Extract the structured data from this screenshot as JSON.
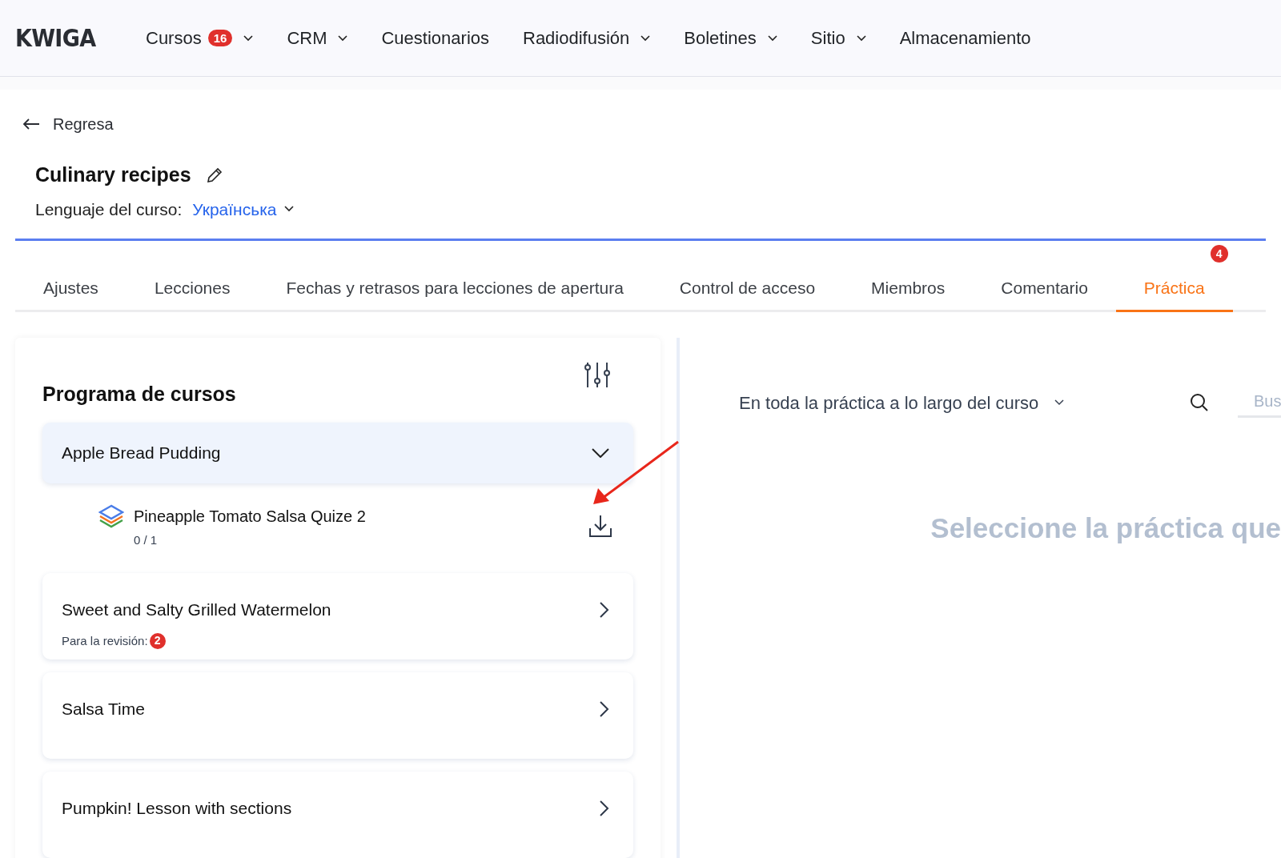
{
  "header": {
    "logo": "KWIGA",
    "nav": [
      {
        "label": "Cursos",
        "badge": "16",
        "has_menu": true
      },
      {
        "label": "CRM",
        "has_menu": true
      },
      {
        "label": "Cuestionarios",
        "has_menu": false
      },
      {
        "label": "Radiodifusión",
        "has_menu": true
      },
      {
        "label": "Boletines",
        "has_menu": true
      },
      {
        "label": "Sitio",
        "has_menu": true
      },
      {
        "label": "Almacenamiento",
        "has_menu": false
      }
    ]
  },
  "back_link": "Regresa",
  "course": {
    "title": "Culinary recipes",
    "language_label": "Lenguaje del curso:",
    "language": "Українська"
  },
  "tabs": [
    {
      "label": "Ajustes",
      "selected": false
    },
    {
      "label": "Lecciones",
      "selected": false
    },
    {
      "label": "Fechas y retrasos para lecciones de apertura",
      "selected": false
    },
    {
      "label": "Control de acceso",
      "selected": false
    },
    {
      "label": "Miembros",
      "selected": false
    },
    {
      "label": "Comentario",
      "selected": false
    },
    {
      "label": "Práctica",
      "selected": true,
      "badge": "4"
    }
  ],
  "program": {
    "title": "Programa de cursos",
    "lessons": [
      {
        "title": "Apple Bread Pudding",
        "expanded": true,
        "children": [
          {
            "title": "Pineapple Tomato Salsa Quize 2",
            "progress": "0 / 1"
          }
        ]
      },
      {
        "title": "Sweet and Salty Grilled Watermelon",
        "expanded": false,
        "review_label": "Para la revisión:",
        "review_count": "2"
      },
      {
        "title": "Salsa Time",
        "expanded": false
      },
      {
        "title": "Pumpkin! Lesson with sections",
        "expanded": false
      }
    ]
  },
  "practice": {
    "filter": "En toda la práctica a lo largo del curso",
    "search": {
      "placeholder": "Bus"
    },
    "empty_message": "Seleccione la práctica que"
  }
}
